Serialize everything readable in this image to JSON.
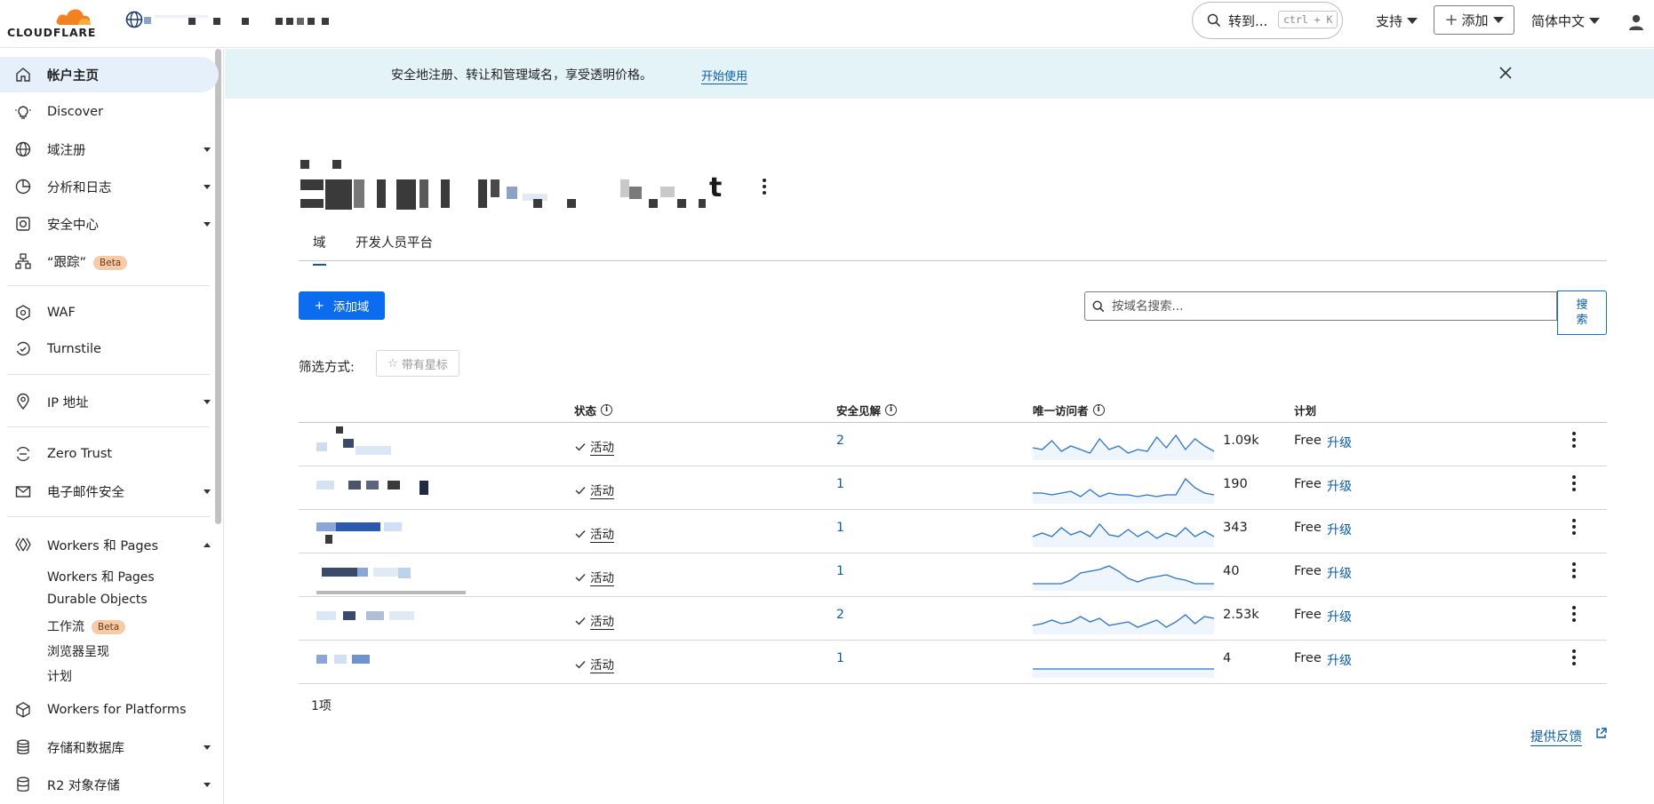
{
  "brand": {
    "logo_text": "CLOUDFLARE"
  },
  "topbar": {
    "goto_label": "转到...",
    "goto_shortcut": "ctrl + K",
    "support_label": "支持",
    "add_label": "添加",
    "language_label": "简体中文"
  },
  "sidebar": {
    "items": [
      {
        "label": "帐户主页",
        "icon": "home-icon"
      },
      {
        "label": "Discover",
        "icon": "lightbulb-icon"
      },
      {
        "label": "域注册",
        "icon": "globe-icon"
      },
      {
        "label": "分析和日志",
        "icon": "chart-icon"
      },
      {
        "label": "安全中心",
        "icon": "shield-center-icon"
      },
      {
        "label": "“跟踪”",
        "icon": "sitemap-icon",
        "badge": "Beta"
      },
      {
        "label": "WAF",
        "icon": "waf-icon"
      },
      {
        "label": "Turnstile",
        "icon": "turnstile-icon"
      },
      {
        "label": "IP 地址",
        "icon": "location-pin-icon"
      },
      {
        "label": "Zero Trust",
        "icon": "zero-trust-icon"
      },
      {
        "label": "电子邮件安全",
        "icon": "email-icon"
      },
      {
        "label": "Workers 和 Pages",
        "icon": "workers-icon"
      },
      {
        "label": "Workers for Platforms",
        "icon": "cube-icon"
      },
      {
        "label": "存储和数据库",
        "icon": "database-icon"
      },
      {
        "label": "R2 对象存储",
        "icon": "storage-icon"
      }
    ],
    "workers_sub": [
      {
        "label": "Workers 和 Pages"
      },
      {
        "label": "Durable Objects"
      },
      {
        "label": "工作流",
        "badge": "Beta"
      },
      {
        "label": "浏览器呈现"
      },
      {
        "label": "计划"
      }
    ]
  },
  "banner": {
    "message": "安全地注册、转让和管理域名，享受透明价格。",
    "link": "开始使用"
  },
  "page": {
    "title_suffix": "t",
    "tabs": [
      "域",
      "开发人员平台"
    ],
    "add_domain_label": "添加域",
    "search_placeholder": "按域名搜索...",
    "search_button": [
      "搜",
      "索"
    ],
    "filter_label": "筛选方式:",
    "starred_chip": "带有星标"
  },
  "table": {
    "headers": {
      "status": "状态",
      "insights": "安全见解",
      "visitors": "唯一访问者",
      "plan": "计划"
    },
    "rows": [
      {
        "status": "活动",
        "insights": "2",
        "visitors": "1.09k",
        "plan": "Free",
        "upgrade": "升级",
        "trend": [
          20,
          22,
          12,
          24,
          18,
          22,
          26,
          10,
          22,
          18,
          26,
          22,
          24,
          8,
          20,
          6,
          22,
          10,
          18,
          24
        ]
      },
      {
        "status": "活动",
        "insights": "1",
        "visitors": "190",
        "plan": "Free",
        "upgrade": "升级",
        "trend": [
          22,
          22,
          24,
          22,
          20,
          26,
          18,
          26,
          22,
          24,
          24,
          26,
          24,
          26,
          24,
          24,
          6,
          16,
          22,
          24
        ]
      },
      {
        "status": "活动",
        "insights": "1",
        "visitors": "343",
        "plan": "Free",
        "upgrade": "升级",
        "trend": [
          22,
          18,
          22,
          12,
          20,
          16,
          22,
          8,
          20,
          22,
          14,
          22,
          16,
          24,
          18,
          22,
          12,
          22,
          16,
          22
        ]
      },
      {
        "status": "活动",
        "insights": "1",
        "visitors": "40",
        "plan": "Free",
        "upgrade": "升级",
        "trend": [
          26,
          26,
          26,
          26,
          22,
          14,
          12,
          10,
          6,
          12,
          20,
          24,
          20,
          18,
          16,
          20,
          22,
          26,
          26,
          26
        ]
      },
      {
        "status": "活动",
        "insights": "2",
        "visitors": "2.53k",
        "plan": "Free",
        "upgrade": "升级",
        "trend": [
          24,
          22,
          18,
          22,
          20,
          14,
          20,
          16,
          24,
          22,
          20,
          26,
          22,
          18,
          26,
          20,
          12,
          22,
          14,
          16
        ]
      },
      {
        "status": "活动",
        "insights": "1",
        "visitors": "4",
        "plan": "Free",
        "upgrade": "升级",
        "trend": [
          24,
          24,
          24,
          24,
          24,
          24,
          24,
          24,
          24,
          24,
          24,
          24,
          24,
          24,
          24,
          24,
          24,
          24,
          24,
          24
        ]
      }
    ]
  },
  "footer": {
    "count": "1项",
    "feedback": "提供反馈"
  }
}
